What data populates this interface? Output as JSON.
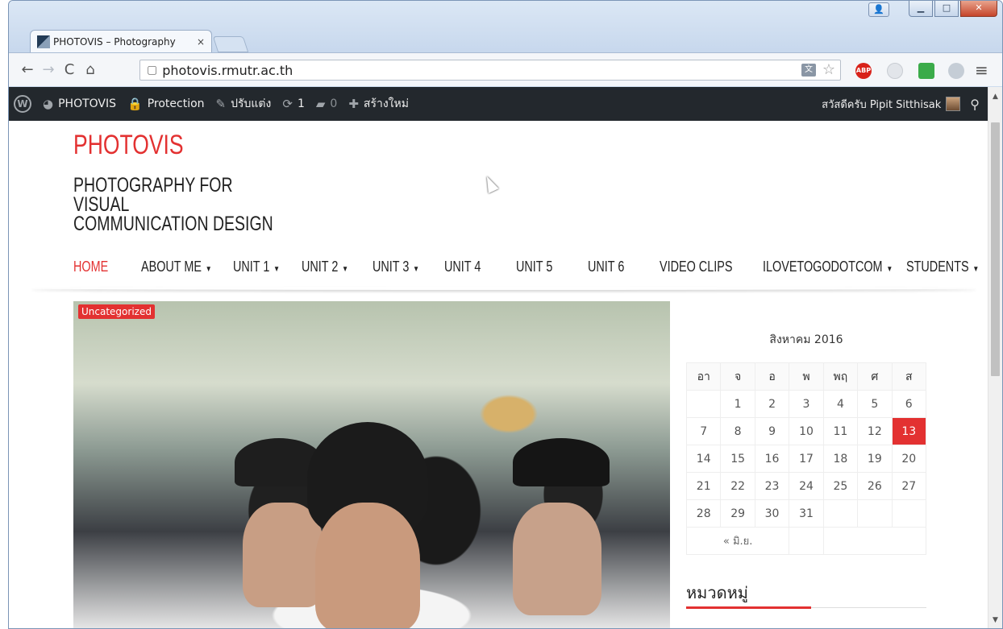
{
  "browser": {
    "tab_title": "PHOTOVIS – Photography",
    "tab_close": "×",
    "url": "photovis.rmutr.ac.th",
    "abp_label": "ABP"
  },
  "admin_bar": {
    "site_name": "PHOTOVIS",
    "protection": "Protection",
    "customize": "ปรับแต่ง",
    "updates_count": "1",
    "comments_count": "0",
    "new_label": "สร้างใหม่",
    "greeting": "สวัสดีครับ Pipit Sitthisak"
  },
  "site": {
    "title": "PHOTOVIS",
    "description_line1": "PHOTOGRAPHY FOR VISUAL",
    "description_line2": "COMMUNICATION DESIGN"
  },
  "nav": {
    "items": [
      {
        "label": "HOME",
        "caret": ""
      },
      {
        "label": "ABOUT ME",
        "caret": "▼"
      },
      {
        "label": "UNIT 1",
        "caret": "▼"
      },
      {
        "label": "UNIT 2",
        "caret": "▼"
      },
      {
        "label": "UNIT 3",
        "caret": "▼"
      },
      {
        "label": "UNIT 4",
        "caret": ""
      },
      {
        "label": "UNIT 5",
        "caret": ""
      },
      {
        "label": "UNIT 6",
        "caret": ""
      },
      {
        "label": "VIDEO CLIPS",
        "caret": ""
      },
      {
        "label": "ILOVETOGODOTCOM",
        "caret": "▼"
      },
      {
        "label": "STUDENTS",
        "caret": "▼"
      }
    ]
  },
  "post": {
    "category": "Uncategorized"
  },
  "calendar": {
    "caption": "สิงหาคม 2016",
    "headers": [
      "อา",
      "จ",
      "อ",
      "พ",
      "พฤ",
      "ศ",
      "ส"
    ],
    "weeks": [
      [
        "",
        "1",
        "2",
        "3",
        "4",
        "5",
        "6"
      ],
      [
        "7",
        "8",
        "9",
        "10",
        "11",
        "12",
        "13"
      ],
      [
        "14",
        "15",
        "16",
        "17",
        "18",
        "19",
        "20"
      ],
      [
        "21",
        "22",
        "23",
        "24",
        "25",
        "26",
        "27"
      ],
      [
        "28",
        "29",
        "30",
        "31",
        "",
        "",
        ""
      ]
    ],
    "today": "13",
    "prev_link": "« มิ.ย."
  },
  "widgets": {
    "categories_title": "หมวดหมู่"
  },
  "colors": {
    "accent": "#e33131",
    "admin_bar": "#23282d"
  }
}
